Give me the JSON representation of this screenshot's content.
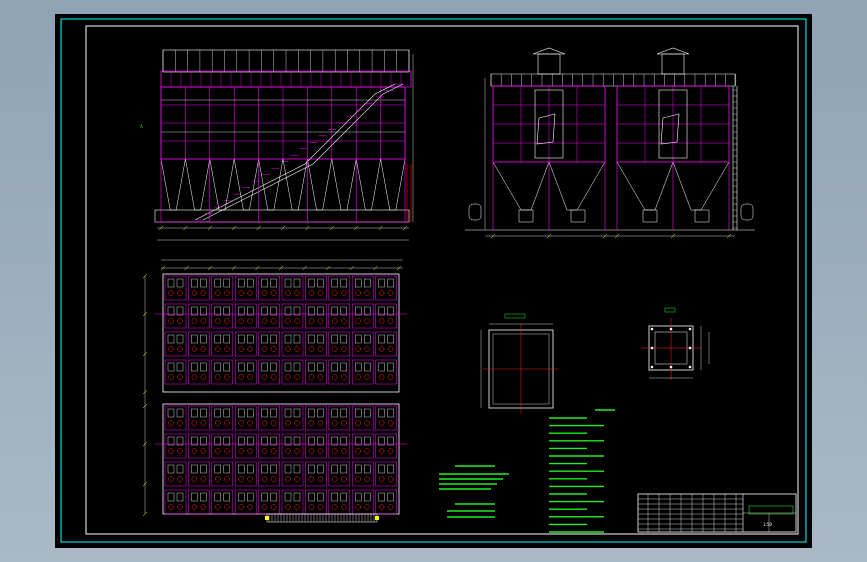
{
  "drawing": {
    "scale_label": "1:50",
    "colors": {
      "frame": "#ffffff",
      "border": "#00ffff",
      "structure": "#ff00ff",
      "outline": "#ffffff",
      "dims": "#ffff00",
      "centerline": "#ff2020",
      "notes": "#22ee22",
      "hopper": "#ff0000"
    },
    "views": [
      "front-elevation",
      "side-elevation",
      "plan-view",
      "section-detail",
      "flange-detail",
      "notes",
      "title-block"
    ]
  }
}
